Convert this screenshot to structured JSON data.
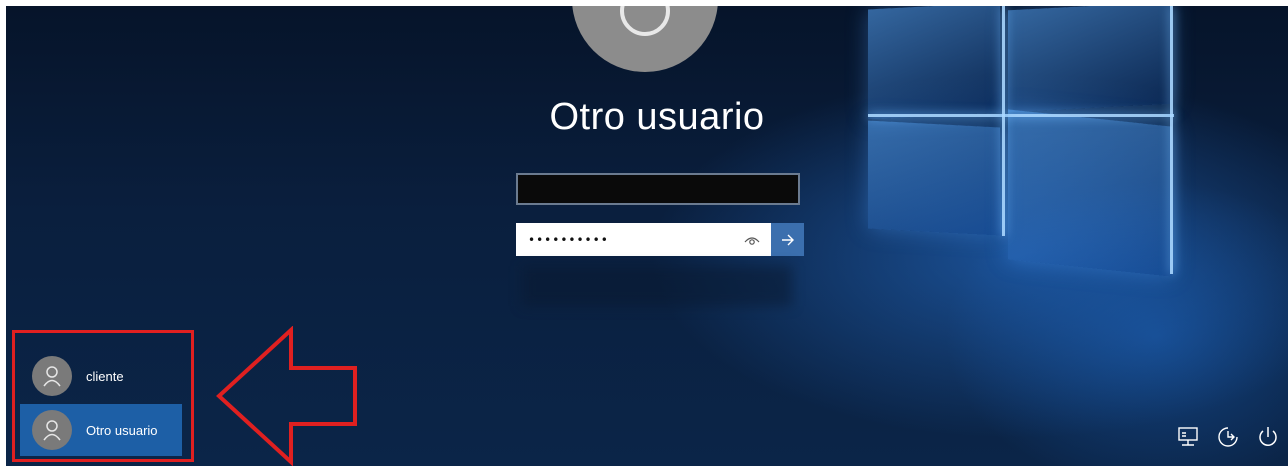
{
  "login": {
    "user_title": "Otro usuario",
    "password_masked": "••••••••••"
  },
  "user_list": [
    {
      "label": "cliente",
      "selected": false
    },
    {
      "label": "Otro usuario",
      "selected": true
    }
  ],
  "icons": {
    "reveal": "eye-icon",
    "submit": "arrow-right-icon",
    "avatar": "person-icon",
    "network": "network-icon",
    "accessibility": "ease-of-access-icon",
    "power": "power-icon"
  },
  "colors": {
    "selected_user": "#1d5fa6",
    "submit_button": "#3b6fae",
    "highlight": "#e02020"
  }
}
